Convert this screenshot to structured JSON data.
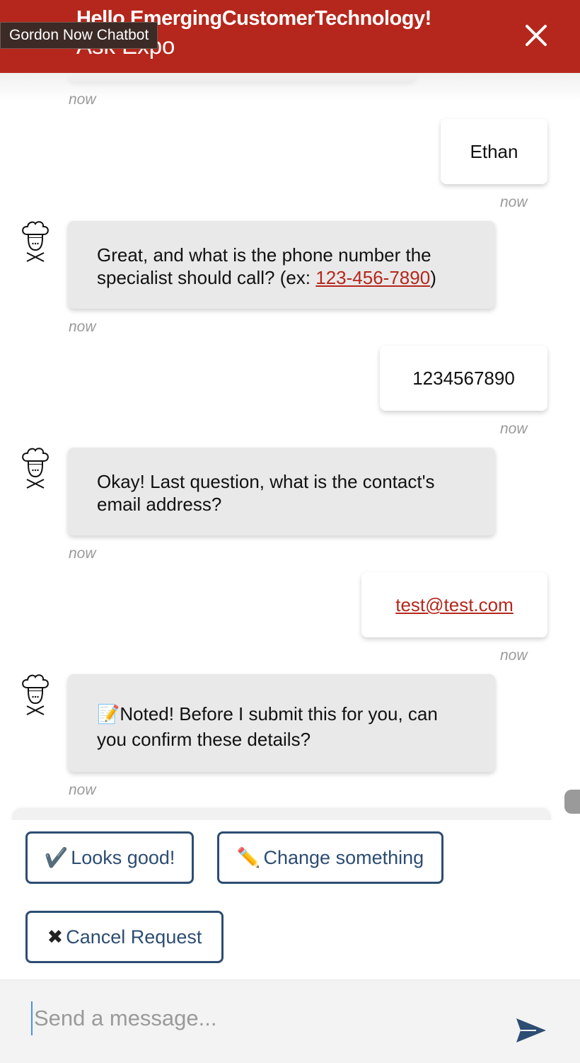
{
  "tooltip": "Gordon Now Chatbot",
  "header": {
    "greeting": "Hello EmergingCustomerTechnology!",
    "title": "Ask Expo"
  },
  "messages": [
    {
      "from": "user",
      "text": "Ethan",
      "time": "now"
    },
    {
      "from": "bot",
      "text_before": "Great, and what is the phone number the specialist should call? (ex: ",
      "link": "123-456-7890",
      "text_after": ")",
      "time": "now"
    },
    {
      "from": "user",
      "text": "1234567890",
      "time": "now"
    },
    {
      "from": "bot",
      "text": "Okay! Last question, what is the contact's email address?",
      "time": "now"
    },
    {
      "from": "user",
      "link": "test@test.com",
      "time": "now"
    },
    {
      "from": "bot",
      "emoji": "📝",
      "text": "Noted! Before I submit this for you, can you confirm these details?",
      "time": "now"
    }
  ],
  "top_timestamp": "now",
  "quick_replies": [
    {
      "emoji": "✔️",
      "label": "Looks good!"
    },
    {
      "emoji": "✏️",
      "label": "Change something"
    },
    {
      "emoji": "✖",
      "label": "Cancel Request"
    }
  ],
  "composer": {
    "placeholder": "Send a message..."
  },
  "colors": {
    "header": "#b5271c",
    "button_border": "#2d4d72",
    "link": "#b5271c",
    "send_icon": "#2d4d72"
  }
}
